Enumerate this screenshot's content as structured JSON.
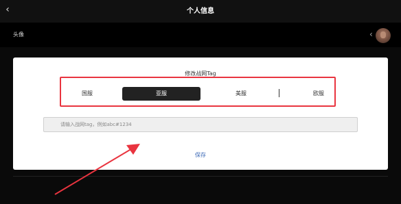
{
  "header": {
    "title": "个人信息",
    "back_icon": "chevron-left-icon"
  },
  "profile": {
    "avatar_label": "头像",
    "chevron_icon": "chevron-right-icon"
  },
  "modal": {
    "title": "修改战网Tag",
    "regions": [
      "国服",
      "亚服",
      "美服",
      "欧服"
    ],
    "selected_region": "亚服",
    "input_placeholder": "请输入战网tag，例如abc#1234",
    "save_label": "保存"
  },
  "colors": {
    "highlight": "#e9343f",
    "arrow": "#e9343f",
    "link": "#3967b5"
  }
}
